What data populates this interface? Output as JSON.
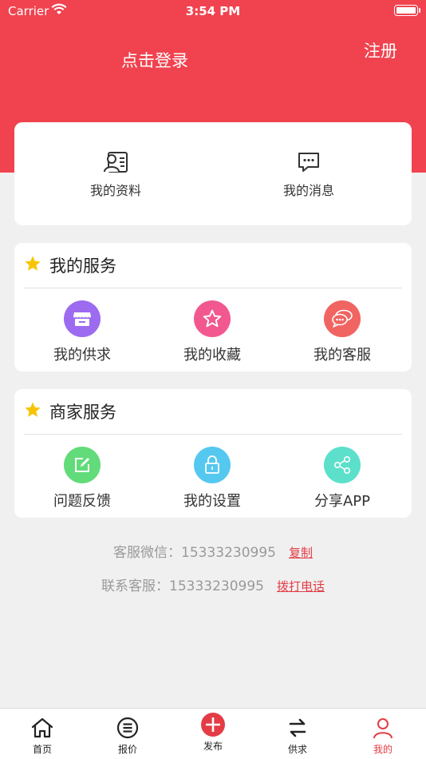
{
  "status_bar": {
    "carrier": "Carrier",
    "time": "3:54 PM"
  },
  "header": {
    "login_label": "点击登录",
    "register_label": "注册"
  },
  "profile_card": {
    "items": [
      {
        "label": "我的资料",
        "icon": "profile-card-icon"
      },
      {
        "label": "我的消息",
        "icon": "message-icon"
      }
    ]
  },
  "my_services": {
    "title": "我的服务",
    "items": [
      {
        "label": "我的供求",
        "icon": "store-icon",
        "color": "#9c6bf0"
      },
      {
        "label": "我的收藏",
        "icon": "star-outline-icon",
        "color": "#f2588f"
      },
      {
        "label": "我的客服",
        "icon": "chat-bubbles-icon",
        "color": "#f06461"
      }
    ]
  },
  "merchant_services": {
    "title": "商家服务",
    "items": [
      {
        "label": "问题反馈",
        "icon": "edit-icon",
        "color": "#62db7a"
      },
      {
        "label": "我的设置",
        "icon": "lock-icon",
        "color": "#55c8f0"
      },
      {
        "label": "分享APP",
        "icon": "share-icon",
        "color": "#5ce0cb"
      }
    ]
  },
  "contact": {
    "wechat_text": "客服微信：15333230995",
    "wechat_action": "复制",
    "phone_text": "联系客服：15333230995",
    "phone_action": "拨打电话"
  },
  "tabbar": {
    "tabs": [
      {
        "label": "首页",
        "icon": "home-icon"
      },
      {
        "label": "报价",
        "icon": "list-icon"
      },
      {
        "label": "发布",
        "icon": "plus-circle-icon"
      },
      {
        "label": "供求",
        "icon": "swap-arrows-icon"
      },
      {
        "label": "我的",
        "icon": "user-icon",
        "active": true
      }
    ]
  },
  "colors": {
    "brand": "#f0434f",
    "active": "#e33c45",
    "star": "#f7c500"
  }
}
